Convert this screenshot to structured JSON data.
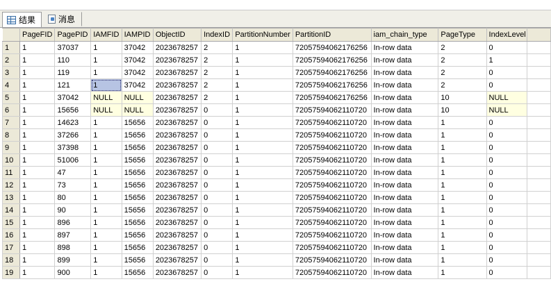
{
  "tabs": [
    {
      "label": "结果",
      "icon": "grid-icon",
      "active": true
    },
    {
      "label": "消息",
      "icon": "message-icon",
      "active": false
    }
  ],
  "columns": [
    "PageFID",
    "PagePID",
    "IAMFID",
    "IAMPID",
    "ObjectID",
    "IndexID",
    "PartitionNumber",
    "PartitionID",
    "iam_chain_type",
    "PageType",
    "IndexLevel"
  ],
  "rows": [
    [
      "1",
      "1",
      "37037",
      "1",
      "37042",
      "2023678257",
      "2",
      "1",
      "72057594062176256",
      "In-row data",
      "2",
      "0"
    ],
    [
      "2",
      "1",
      "110",
      "1",
      "37042",
      "2023678257",
      "2",
      "1",
      "72057594062176256",
      "In-row data",
      "2",
      "1"
    ],
    [
      "3",
      "1",
      "119",
      "1",
      "37042",
      "2023678257",
      "2",
      "1",
      "72057594062176256",
      "In-row data",
      "2",
      "0"
    ],
    [
      "4",
      "1",
      "121",
      "1",
      "37042",
      "2023678257",
      "2",
      "1",
      "72057594062176256",
      "In-row data",
      "2",
      "0"
    ],
    [
      "5",
      "1",
      "37042",
      "NULL",
      "NULL",
      "2023678257",
      "2",
      "1",
      "72057594062176256",
      "In-row data",
      "10",
      "NULL"
    ],
    [
      "6",
      "1",
      "15656",
      "NULL",
      "NULL",
      "2023678257",
      "0",
      "1",
      "72057594062110720",
      "In-row data",
      "10",
      "NULL"
    ],
    [
      "7",
      "1",
      "14623",
      "1",
      "15656",
      "2023678257",
      "0",
      "1",
      "72057594062110720",
      "In-row data",
      "1",
      "0"
    ],
    [
      "8",
      "1",
      "37266",
      "1",
      "15656",
      "2023678257",
      "0",
      "1",
      "72057594062110720",
      "In-row data",
      "1",
      "0"
    ],
    [
      "9",
      "1",
      "37398",
      "1",
      "15656",
      "2023678257",
      "0",
      "1",
      "72057594062110720",
      "In-row data",
      "1",
      "0"
    ],
    [
      "10",
      "1",
      "51006",
      "1",
      "15656",
      "2023678257",
      "0",
      "1",
      "72057594062110720",
      "In-row data",
      "1",
      "0"
    ],
    [
      "11",
      "1",
      "47",
      "1",
      "15656",
      "2023678257",
      "0",
      "1",
      "72057594062110720",
      "In-row data",
      "1",
      "0"
    ],
    [
      "12",
      "1",
      "73",
      "1",
      "15656",
      "2023678257",
      "0",
      "1",
      "72057594062110720",
      "In-row data",
      "1",
      "0"
    ],
    [
      "13",
      "1",
      "80",
      "1",
      "15656",
      "2023678257",
      "0",
      "1",
      "72057594062110720",
      "In-row data",
      "1",
      "0"
    ],
    [
      "14",
      "1",
      "90",
      "1",
      "15656",
      "2023678257",
      "0",
      "1",
      "72057594062110720",
      "In-row data",
      "1",
      "0"
    ],
    [
      "15",
      "1",
      "896",
      "1",
      "15656",
      "2023678257",
      "0",
      "1",
      "72057594062110720",
      "In-row data",
      "1",
      "0"
    ],
    [
      "16",
      "1",
      "897",
      "1",
      "15656",
      "2023678257",
      "0",
      "1",
      "72057594062110720",
      "In-row data",
      "1",
      "0"
    ],
    [
      "17",
      "1",
      "898",
      "1",
      "15656",
      "2023678257",
      "0",
      "1",
      "72057594062110720",
      "In-row data",
      "1",
      "0"
    ],
    [
      "18",
      "1",
      "899",
      "1",
      "15656",
      "2023678257",
      "0",
      "1",
      "72057594062110720",
      "In-row data",
      "1",
      "0"
    ],
    [
      "19",
      "1",
      "900",
      "1",
      "15656",
      "2023678257",
      "0",
      "1",
      "72057594062110720",
      "In-row data",
      "1",
      "0"
    ]
  ],
  "selected_cell": {
    "row": 4,
    "column": "IAMFID"
  },
  "colors": {
    "header_bg": "#ece9d8",
    "null_bg": "#ffffe1",
    "selected_bg": "#b7c4e3"
  }
}
